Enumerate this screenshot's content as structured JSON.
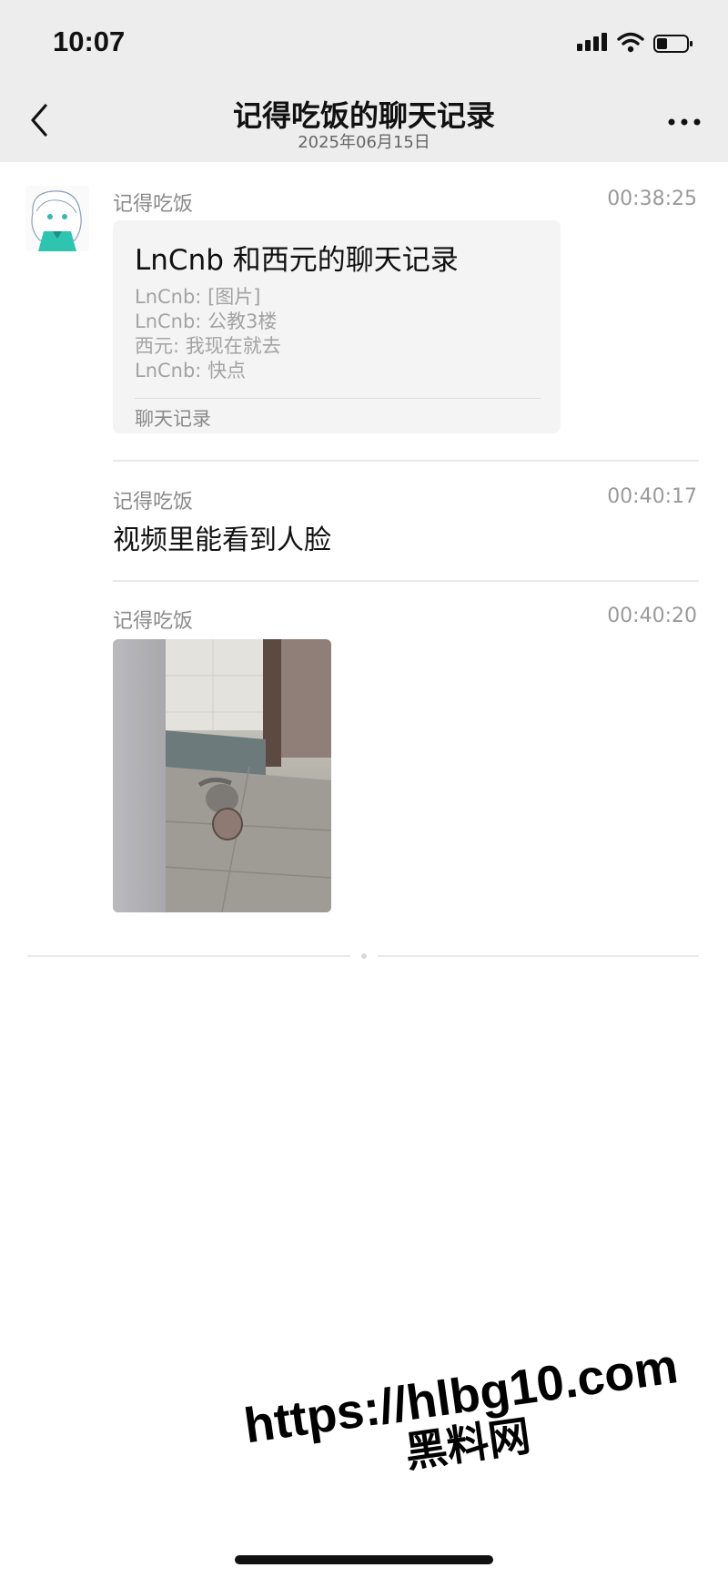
{
  "status_bar": {
    "time": "10:07"
  },
  "nav": {
    "title": "记得吃饭的聊天记录",
    "subtitle": "2025年06月15日",
    "back_icon": "chevron-left-icon",
    "more_icon": "more-dots-icon"
  },
  "messages": [
    {
      "sender": "记得吃饭",
      "time": "00:38:25",
      "type": "chat-record",
      "record": {
        "title": "LnCnb 和西元的聊天记录",
        "lines": [
          "LnCnb: [图片]",
          "LnCnb: 公教3楼",
          "西元: 我现在就去",
          "LnCnb: 快点"
        ],
        "footer": "聊天记录"
      }
    },
    {
      "sender": "记得吃饭",
      "time": "00:40:17",
      "type": "text",
      "text": "视频里能看到人脸"
    },
    {
      "sender": "记得吃饭",
      "time": "00:40:20",
      "type": "image"
    }
  ],
  "watermark": {
    "url": "https://hlbg10.com",
    "name": "黑料网"
  },
  "colors": {
    "header_bg": "#ededed",
    "card_bg": "#f4f4f4",
    "meta_text": "#8a8a8a"
  }
}
